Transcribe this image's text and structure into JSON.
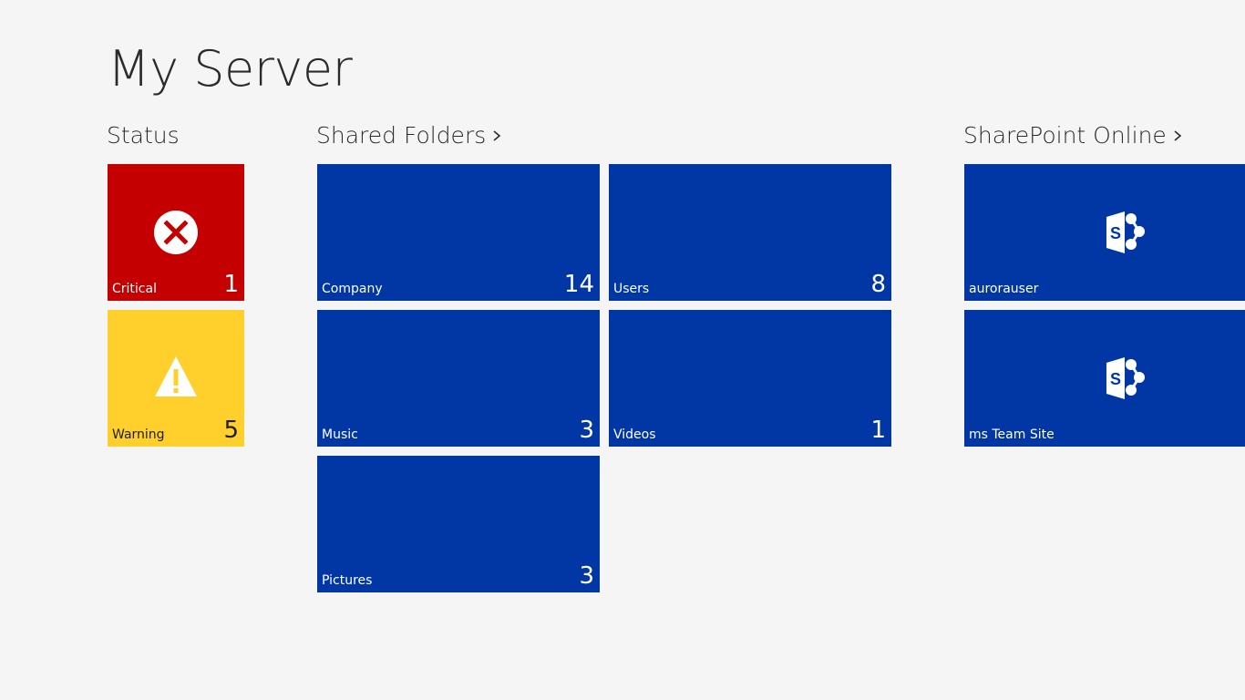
{
  "app": {
    "title": "My Server"
  },
  "groups": {
    "status": {
      "header": "Status"
    },
    "shared_folders": {
      "header": "Shared Folders"
    },
    "sharepoint": {
      "header": "SharePoint Online"
    }
  },
  "status_tiles": [
    {
      "label": "Critical",
      "count": "1",
      "icon": "error-x-icon",
      "color": "#c40000"
    },
    {
      "label": "Warning",
      "count": "5",
      "icon": "warning-triangle-icon",
      "color": "#ffcf2b"
    }
  ],
  "folder_tiles": [
    {
      "label": "Company",
      "count": "14"
    },
    {
      "label": "Users",
      "count": "8"
    },
    {
      "label": "Music",
      "count": "3"
    },
    {
      "label": "Videos",
      "count": "1"
    },
    {
      "label": "Pictures",
      "count": "3"
    }
  ],
  "sharepoint_tiles": [
    {
      "label": "aurorauser",
      "icon": "sharepoint-icon"
    },
    {
      "label": "ms Team Site",
      "icon": "sharepoint-icon"
    }
  ],
  "colors": {
    "background": "#f5f5f5",
    "tile_blue": "#0037a5",
    "critical_red": "#c40000",
    "warning_yellow": "#ffcf2b"
  }
}
